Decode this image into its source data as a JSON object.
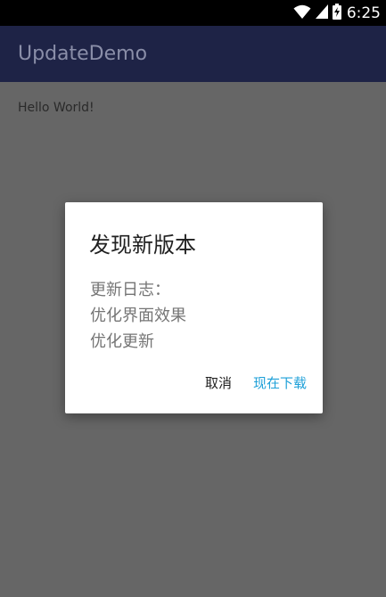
{
  "status_bar": {
    "time": "6:25",
    "icons": [
      "wifi-icon",
      "signal-icon",
      "battery-charging-icon"
    ]
  },
  "app_bar": {
    "title": "UpdateDemo"
  },
  "content": {
    "text": "Hello World!"
  },
  "dialog": {
    "title": "发现新版本",
    "body_lines": [
      "更新日志：",
      "优化界面效果",
      "优化更新"
    ],
    "cancel_label": "取消",
    "download_label": "现在下载"
  },
  "colors": {
    "status_bar": "#000000",
    "app_bar": "#1e2346",
    "scrim_background": "#666666",
    "dialog_background": "#ffffff",
    "accent": "#1ea0d8"
  }
}
